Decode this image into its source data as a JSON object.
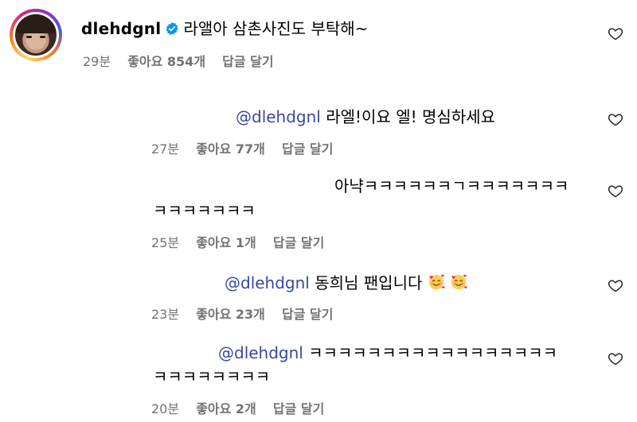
{
  "comment": {
    "username": "dlehdgnl",
    "text": "라앨아 삼촌사진도 부탁해~",
    "time": "29분",
    "likes": "좋아요 854개",
    "reply": "답글 달기"
  },
  "replies": [
    {
      "mention": "@dlehdgnl",
      "text": " 라엘!이요 엘! 명심하세요",
      "time": "27분",
      "likes": "좋아요 77개",
      "reply": "답글 달기"
    },
    {
      "line1": "아냑ㅋㅋㅋㅋㅋㅋㄱㅋㅋㅋㅋㅋㅋㅋ",
      "line2": "ㅋㅋㅋㅋㅋㅋㅋ",
      "time": "25분",
      "likes": "좋아요 1개",
      "reply": "답글 달기"
    },
    {
      "mention": "@dlehdgnl",
      "text": " 동희님 팬입니다",
      "emojis": [
        "smiling-face-with-hearts-icon",
        "smiling-face-with-hearts-icon"
      ],
      "time": "23분",
      "likes": "좋아요 23개",
      "reply": "답글 달기"
    },
    {
      "mention": "@dlehdgnl",
      "text": " ㅋㅋㅋㅋㅋㅋㅋㅋㅋㅋㅋㅋㅋㅋㅋㅋㅋ",
      "line2": "ㅋㅋㅋㅋㅋㅋㅋㅋ",
      "time": "20분",
      "likes": "좋아요 2개",
      "reply": "답글 달기"
    }
  ],
  "colors": {
    "mention": "#384a9c",
    "meta": "#737373",
    "verified": "#0095f6"
  }
}
